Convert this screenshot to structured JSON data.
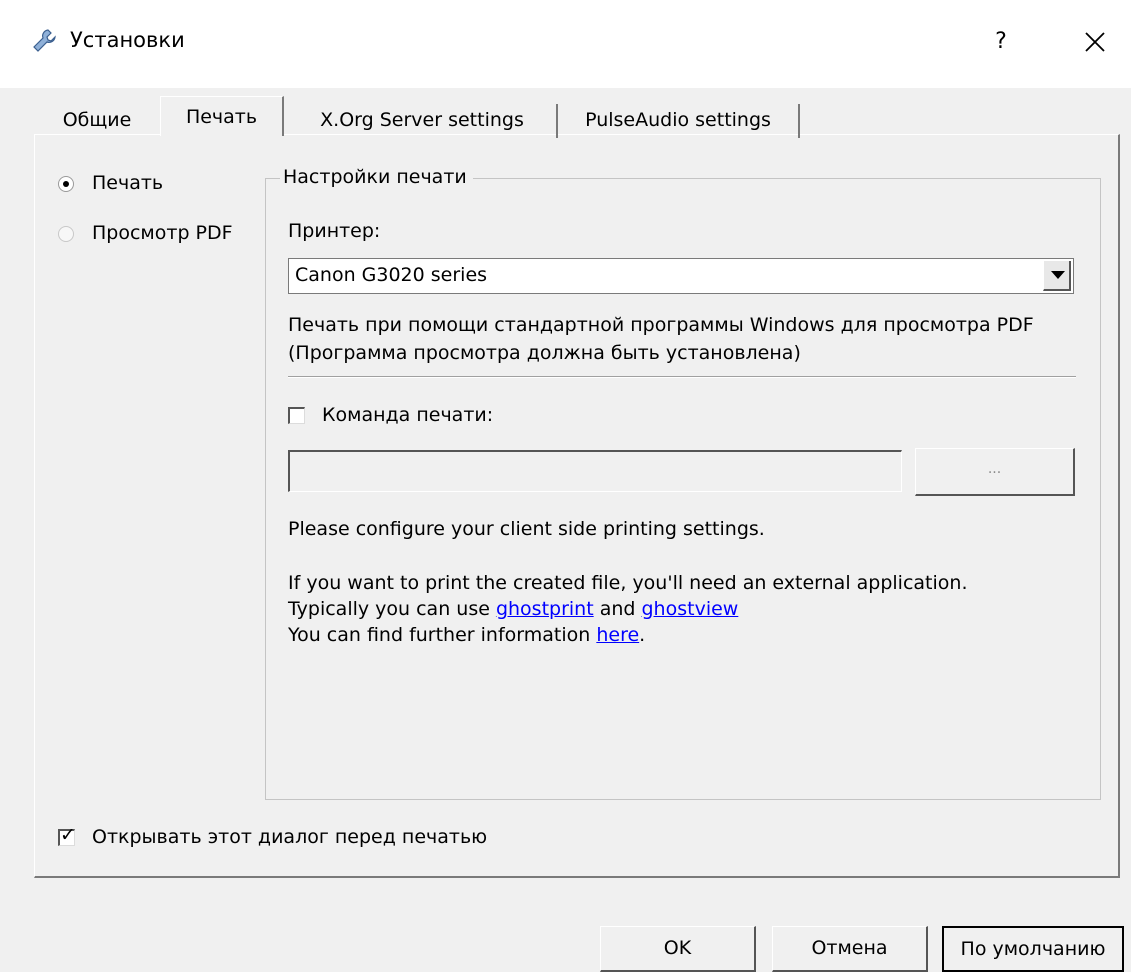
{
  "window": {
    "title": "Установки",
    "help_label": "?",
    "icon": "wrench-icon",
    "close_icon": "close-icon"
  },
  "tabs": [
    {
      "label": "Общие",
      "active": false
    },
    {
      "label": "Печать",
      "active": true
    },
    {
      "label": "X.Org Server settings",
      "active": false
    },
    {
      "label": "PulseAudio settings",
      "active": false
    }
  ],
  "mode": {
    "options": [
      {
        "label": "Печать",
        "selected": true
      },
      {
        "label": "Просмотр PDF",
        "selected": false
      }
    ]
  },
  "print_settings": {
    "group_title": "Настройки печати",
    "printer_label": "Принтер:",
    "printer_value": "Canon G3020 series",
    "info_line1": "Печать при помощи стандартной программы Windows для просмотра PDF",
    "info_line2": "(Программа просмотра должна быть установлена)",
    "print_command_label": "Команда печати:",
    "print_command_checked": false,
    "print_command_value": "",
    "browse_label": "...",
    "configure_text": "Please configure your client side printing settings.",
    "external_text": "If you want to print the created file, you'll need an external application.",
    "typical_prefix": "Typically you can use ",
    "link_ghostprint": "ghostprint",
    "and_text": " and ",
    "link_ghostview": "ghostview",
    "further_prefix": "You can find further information ",
    "link_here": "here",
    "further_suffix": "."
  },
  "show_dialog": {
    "label": "Открывать этот диалог перед печатью",
    "checked": true
  },
  "buttons": {
    "ok": "OK",
    "cancel": "Отмена",
    "defaults": "По умолчанию"
  }
}
